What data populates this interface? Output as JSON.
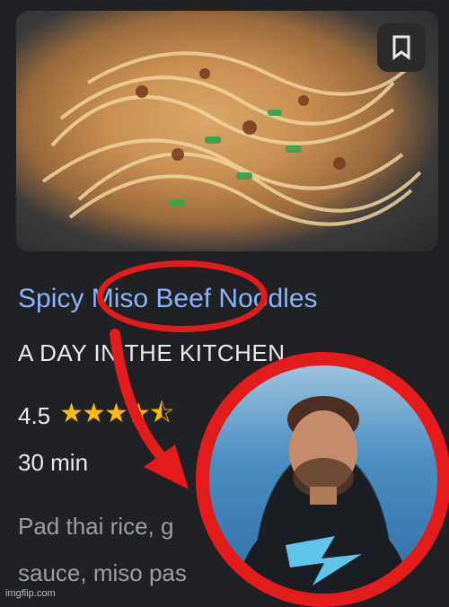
{
  "recipe": {
    "title_prefix": "Spicy ",
    "title_highlight": "Miso Beef",
    "title_suffix": " Noodles",
    "source": "A DAY IN THE KITCHEN",
    "rating": "4.5",
    "stars": "★★★★⯪",
    "time": "30 min",
    "description_line1": "Pad thai rice, g",
    "description_line2": "sauce, miso pas"
  },
  "footer": {
    "watermark": "imgflip.com"
  },
  "colors": {
    "link": "#8ab4f8",
    "annotation_red": "#e41b1b",
    "star": "#fbbc04"
  },
  "icons": {
    "bookmark": "bookmark-icon"
  }
}
